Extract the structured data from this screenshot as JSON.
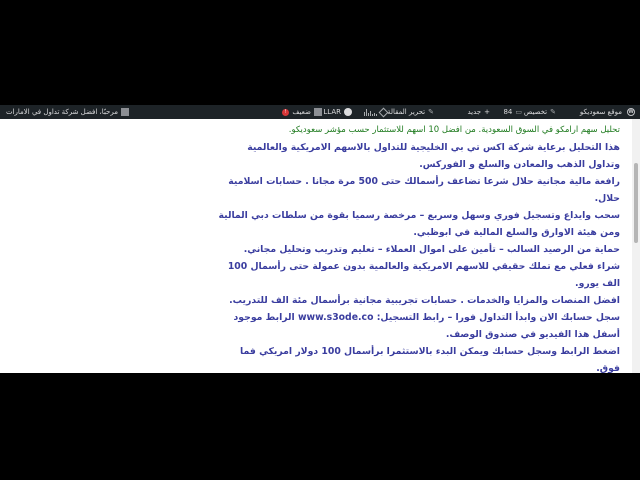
{
  "adminbar": {
    "site_name": "موقع سعوديكو",
    "customize": "تخصيص",
    "comments_count": "84",
    "new_label": "جديد",
    "edit_label": "تحرير المقالة",
    "llar_label": "LLAR",
    "seo_label": "ضعيف",
    "howdy": "مرحبًا، افضل شركة تداول في الامارات"
  },
  "content": {
    "green_intro": "تحليل سهم ارامكو في السوق السعودية. من افضل 10 اسهم للاستثمار حسب مؤشر سعوديكو.",
    "p1": "هذا التحليل برعاية شركة اكس تي بي الخليجية للتداول بالاسهم الامريكية والعالمية وتداول الذهب والمعادن والسلع و الفوركس.",
    "p2": "رافعة مالية مجانية حلال شرعا تضاعف رأسمالك حتى 500 مرة مجانا . حسابات اسلامية حلال.",
    "p3": "سحب وايداع وتسجيل فوري وسهل وسريع – مرخصة رسميا بقوة من سلطات دبي المالية ومن هيئة الاوارق والسلع المالية في ابوظبي.",
    "p4": "حماية من الرصيد السالب – تأمين على اموال العملاء – تعليم وتدريب وتحليل مجاني.",
    "p5": "شراء فعلي مع تملك حقيقي للاسهم الامريكية والعالمية بدون عمولة حتى رأسمال 100 الف يورو.",
    "p6": "افضل المنصات والمزايا والخدمات . حسابات تجريبية مجانية برأسمال مئة الف للتدريب.",
    "p7_before": "سجل حسابك الان وابدأ التداول فورا – رابط التسجيل: ",
    "p7_link": "www.s3ode.co",
    "p7_after": " الرابط موجود أسفل هذا الفيديو في صندوق الوصف.",
    "p8": "اضغط الرابط وسجل حسابك ويمكن البدء بالاستثمرا برأسمال 100 دولار امريكي فما فوق."
  }
}
